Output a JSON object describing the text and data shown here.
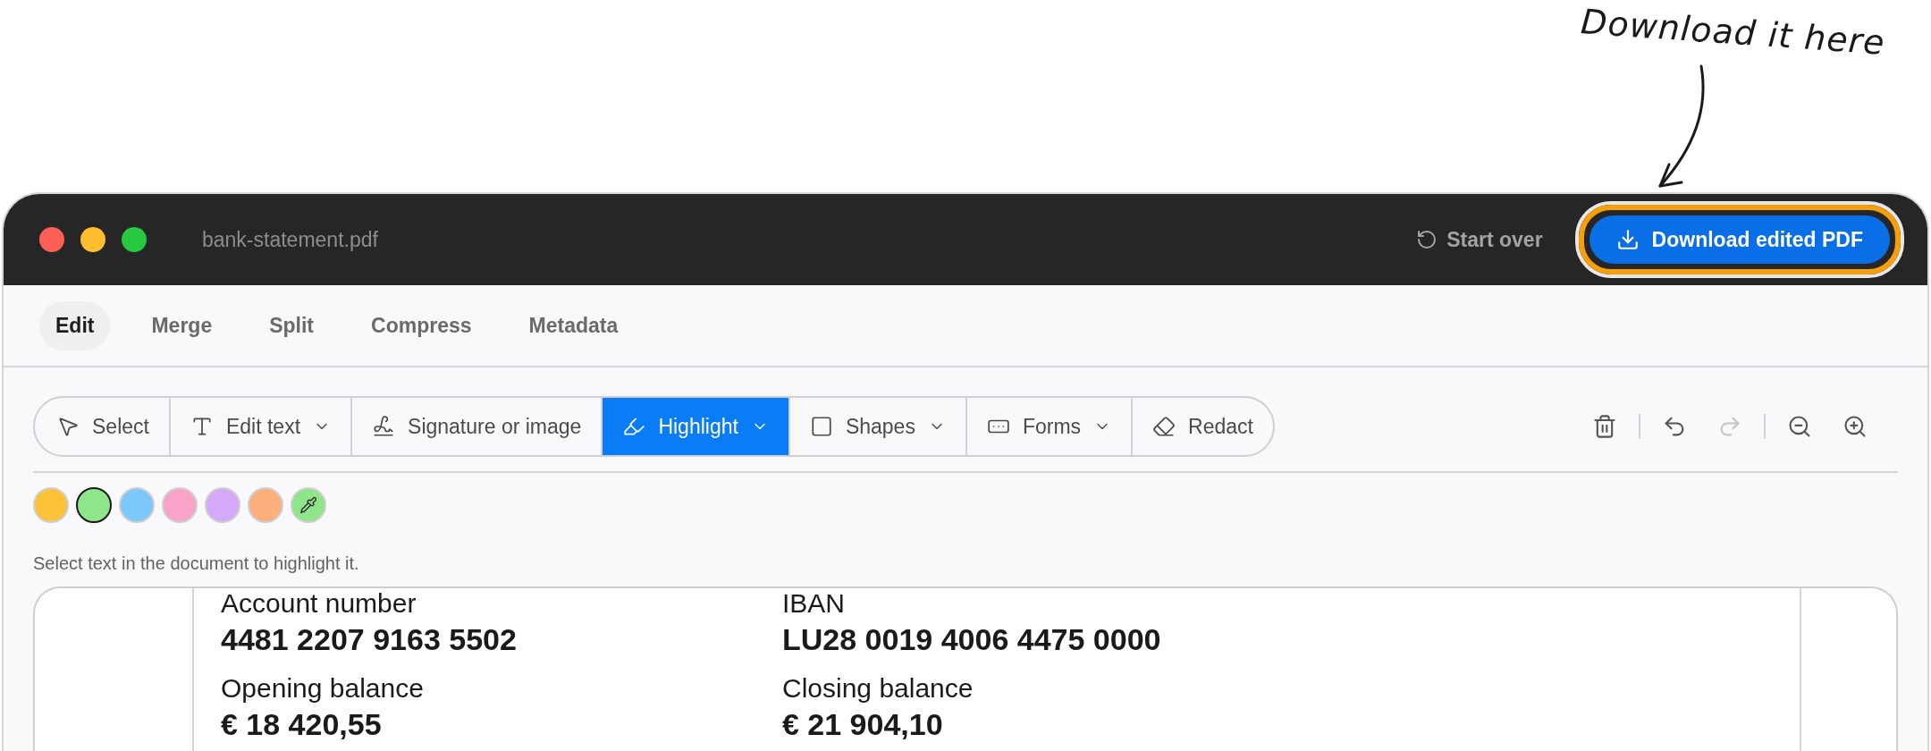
{
  "annotation": {
    "text": "Download it here"
  },
  "window": {
    "title": "bank-statement.pdf",
    "start_over": "Start over",
    "download_button": "Download edited PDF"
  },
  "tabs": [
    {
      "label": "Edit",
      "selected": true
    },
    {
      "label": "Merge",
      "selected": false
    },
    {
      "label": "Split",
      "selected": false
    },
    {
      "label": "Compress",
      "selected": false
    },
    {
      "label": "Metadata",
      "selected": false
    }
  ],
  "tools": [
    {
      "kind": "select",
      "label": "Select",
      "dropdown": false,
      "selected": false
    },
    {
      "kind": "text",
      "label": "Edit text",
      "dropdown": true,
      "selected": false
    },
    {
      "kind": "signature",
      "label": "Signature or image",
      "dropdown": false,
      "selected": false
    },
    {
      "kind": "highlight",
      "label": "Highlight",
      "dropdown": true,
      "selected": true
    },
    {
      "kind": "shapes",
      "label": "Shapes",
      "dropdown": true,
      "selected": false
    },
    {
      "kind": "forms",
      "label": "Forms",
      "dropdown": true,
      "selected": false
    },
    {
      "kind": "redact",
      "label": "Redact",
      "dropdown": false,
      "selected": false
    }
  ],
  "actions": [
    [
      {
        "kind": "delete",
        "disabled": false
      }
    ],
    [
      {
        "kind": "undo",
        "disabled": false
      },
      {
        "kind": "redo",
        "disabled": true
      }
    ],
    [
      {
        "kind": "zoom-out",
        "disabled": false
      },
      {
        "kind": "zoom-in",
        "disabled": false
      }
    ]
  ],
  "swatches": [
    {
      "kind": "color",
      "color": "#fcc339",
      "selected": false
    },
    {
      "kind": "color",
      "color": "#8ee58a",
      "selected": true
    },
    {
      "kind": "color",
      "color": "#7dc8fb",
      "selected": false
    },
    {
      "kind": "color",
      "color": "#f9a3c8",
      "selected": false
    },
    {
      "kind": "color",
      "color": "#d4a9f9",
      "selected": false
    },
    {
      "kind": "color",
      "color": "#fbb07c",
      "selected": false
    },
    {
      "kind": "picker",
      "color": "#8ee58a",
      "selected": false
    }
  ],
  "hint": "Select text in the document to highlight it.",
  "document": {
    "fields": [
      {
        "label": "Account number",
        "value": "4481 2207 9163 5502"
      },
      {
        "label": "IBAN",
        "value": "LU28 0019 4006 4475 0000"
      },
      {
        "label": "Opening balance",
        "value": "€ 18 420,55"
      },
      {
        "label": "Closing balance",
        "value": "€ 21 904,10"
      }
    ]
  }
}
